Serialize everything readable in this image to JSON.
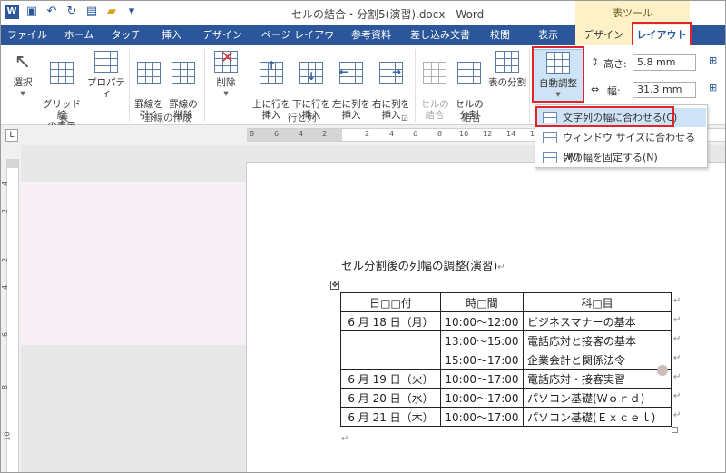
{
  "window": {
    "title": "セルの結合・分割5(演習).docx - Word",
    "table_tools_label": "表ツール"
  },
  "tabs": [
    {
      "label": "ファイル"
    },
    {
      "label": "ホーム"
    },
    {
      "label": "タッチ"
    },
    {
      "label": "挿入"
    },
    {
      "label": "デザイン"
    },
    {
      "label": "ページ レイアウト"
    },
    {
      "label": "参考資料"
    },
    {
      "label": "差し込み文書"
    },
    {
      "label": "校閲"
    },
    {
      "label": "表示"
    },
    {
      "label": "デザイン"
    },
    {
      "label": "レイアウト"
    }
  ],
  "ribbon": {
    "select": "選択",
    "gridlines": "グリッド線\nの表示",
    "properties": "プロパティ",
    "draw_table": "罫線を\n引く",
    "eraser": "罫線の\n削除",
    "delete": "削除",
    "insert_above": "上に行を\n挿入",
    "insert_below": "下に行を\n挿入",
    "insert_left": "左に列を\n挿入",
    "insert_right": "右に列を\n挿入",
    "merge_cells": "セルの\n結合",
    "split_cells": "セルの\n分割",
    "split_table": "表の分割",
    "autofit": "自動調整",
    "height_label": "高さ:",
    "height_value": "5.8 mm",
    "width_label": "幅:",
    "width_value": "31.3 mm",
    "group_table": "表",
    "group_draw": "罫線の作成",
    "group_rows_cols": "行と列",
    "group_merge": "結合"
  },
  "autofit_menu": [
    {
      "label": "文字列の幅に合わせる(C)",
      "highlighted": true
    },
    {
      "label": "ウィンドウ サイズに合わせる(W)",
      "highlighted": false
    },
    {
      "label": "列の幅を固定する(N)",
      "highlighted": false
    }
  ],
  "ruler": {
    "h_numbers": [
      "8",
      "6",
      "4",
      "2",
      "2",
      "4",
      "6",
      "8",
      "10",
      "12",
      "14",
      "16"
    ],
    "v_numbers": [
      "4",
      "2",
      "2",
      "4",
      "6",
      "8",
      "10"
    ]
  },
  "document": {
    "heading": "セル分割後の列幅の調整(演習)",
    "table": {
      "header": [
        "日□□付",
        "時□間",
        "科□目"
      ],
      "rows": [
        [
          "6 月 18 日（月）",
          "10:00～12:00",
          "ビジネスマナーの基本"
        ],
        [
          "",
          "13:00～15:00",
          "電話応対と接客の基本"
        ],
        [
          "",
          "15:00～17:00",
          "企業会計と関係法令"
        ],
        [
          "6 月 19 日（火）",
          "10:00～17:00",
          "電話応対・接客実習"
        ],
        [
          "6 月 20 日（水）",
          "10:00～17:00",
          "パソコン基礎(Ｗｏｒｄ)"
        ],
        [
          "6 月 21 日（木）",
          "10:00～17:00",
          "パソコン基礎(Ｅｘｃｅｌ)"
        ]
      ]
    }
  },
  "colors": {
    "word_blue": "#2b579a",
    "highlight_red": "#e0242b",
    "table_tools_tab": "#fdf1c8",
    "menu_highlight": "#cfe3f7"
  }
}
